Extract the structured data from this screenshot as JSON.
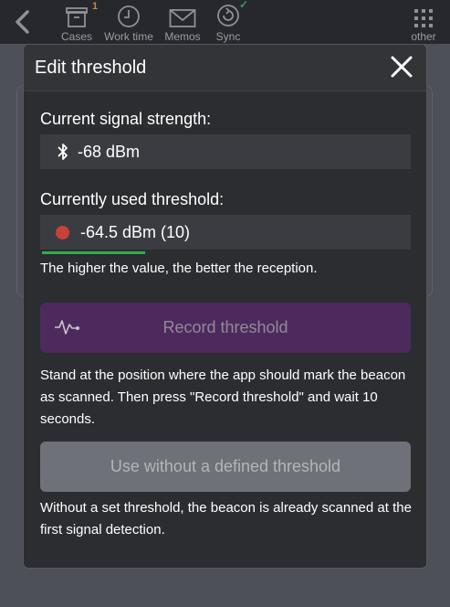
{
  "topbar": {
    "back_icon": "chevron-left-icon",
    "items": [
      {
        "label": "Cases",
        "icon": "inbox-icon",
        "badge": "1"
      },
      {
        "label": "Work time",
        "icon": "clock-icon"
      },
      {
        "label": "Memos",
        "icon": "envelope-icon"
      },
      {
        "label": "Sync",
        "icon": "sync-icon"
      }
    ],
    "other_label": "other",
    "other_icon": "grid-icon"
  },
  "modal": {
    "title": "Edit threshold",
    "close_icon": "close-icon",
    "signal_label": "Current signal strength:",
    "signal_value": "-68 dBm",
    "signal_icon": "bluetooth-icon",
    "threshold_label": "Currently used threshold:",
    "threshold_value": "-64.5 dBm (10)",
    "threshold_color": "#c8403a",
    "hint_reception": "The higher the value, the better the reception.",
    "record_button": "Record threshold",
    "record_icon": "pulse-icon",
    "record_instructions": "Stand at the position where the app should mark the beacon as scanned. Then press \"Record threshold\" and wait 10 seconds.",
    "no_threshold_button": "Use without a defined threshold",
    "no_threshold_note": "Without a set threshold, the beacon is already scanned at the first signal detection."
  },
  "colors": {
    "accent_purple": "#4c2a5d",
    "green_indicator": "#2fae4e",
    "badge_orange": "#c38a3c"
  }
}
